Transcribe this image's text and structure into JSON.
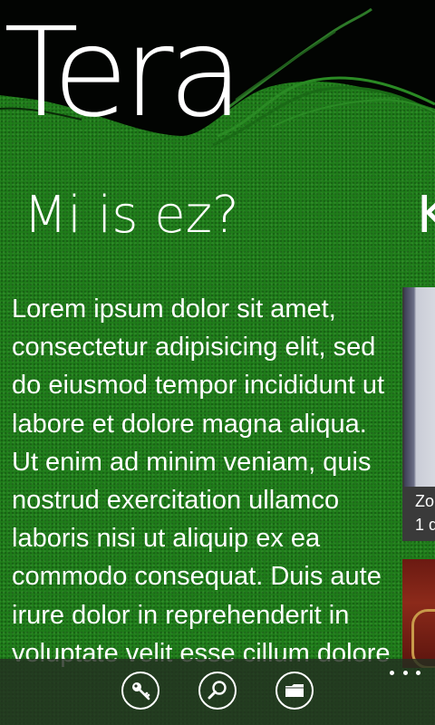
{
  "app": {
    "title": "Tera"
  },
  "sections": {
    "current_title": "Mi is ez?",
    "next_title_partial": "K",
    "body": "Lorem ipsum dolor sit amet, consectetur adipisicing elit, sed do eiusmod tempor incididunt ut labore et dolore magna aliqua. Ut enim ad minim veniam, quis nostrud exercitation ullamco laboris nisi ut aliquip ex ea commodo consequat. Duis aute irure dolor in reprehenderit in voluptate velit esse cillum dolore"
  },
  "next_panel": {
    "tile1_caption_line1": "Zo",
    "tile1_caption_line2": "1 d"
  },
  "app_bar": {
    "buttons": [
      {
        "icon": "key-icon"
      },
      {
        "icon": "search-icon"
      },
      {
        "icon": "folder-icon"
      }
    ],
    "more": "..."
  },
  "colors": {
    "background": "#1f7d1a",
    "app_bar": "#232e21"
  }
}
